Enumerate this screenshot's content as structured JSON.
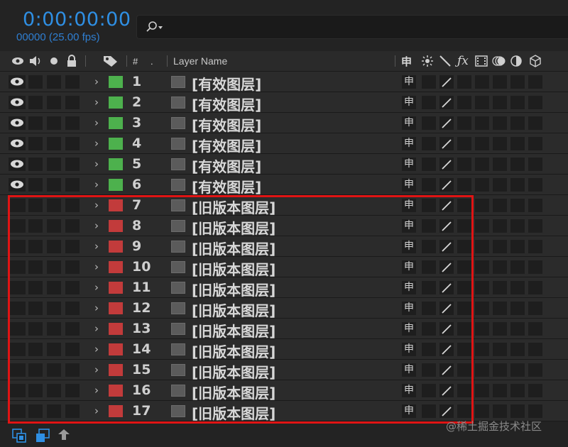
{
  "composition": {
    "timecode": "0:00:00:00",
    "frame_fps": "00000 (25.00 fps)"
  },
  "search": {
    "value": "",
    "icon": "search-icon"
  },
  "header": {
    "number_col": "#",
    "dot_col": ".",
    "layer_name_col": "Layer Name"
  },
  "layers": [
    {
      "num": "1",
      "name": "[有效图层]",
      "visible": true,
      "label_color": "#4db14d"
    },
    {
      "num": "2",
      "name": "[有效图层]",
      "visible": true,
      "label_color": "#4db14d"
    },
    {
      "num": "3",
      "name": "[有效图层]",
      "visible": true,
      "label_color": "#4db14d"
    },
    {
      "num": "4",
      "name": "[有效图层]",
      "visible": true,
      "label_color": "#4db14d"
    },
    {
      "num": "5",
      "name": "[有效图层]",
      "visible": true,
      "label_color": "#4db14d"
    },
    {
      "num": "6",
      "name": "[有效图层]",
      "visible": true,
      "label_color": "#4db14d"
    },
    {
      "num": "7",
      "name": "[旧版本图层]",
      "visible": false,
      "label_color": "#c23b3b"
    },
    {
      "num": "8",
      "name": "[旧版本图层]",
      "visible": false,
      "label_color": "#c23b3b"
    },
    {
      "num": "9",
      "name": "[旧版本图层]",
      "visible": false,
      "label_color": "#c23b3b"
    },
    {
      "num": "10",
      "name": "[旧版本图层]",
      "visible": false,
      "label_color": "#c23b3b"
    },
    {
      "num": "11",
      "name": "[旧版本图层]",
      "visible": false,
      "label_color": "#c23b3b"
    },
    {
      "num": "12",
      "name": "[旧版本图层]",
      "visible": false,
      "label_color": "#c23b3b"
    },
    {
      "num": "13",
      "name": "[旧版本图层]",
      "visible": false,
      "label_color": "#c23b3b"
    },
    {
      "num": "14",
      "name": "[旧版本图层]",
      "visible": false,
      "label_color": "#c23b3b"
    },
    {
      "num": "15",
      "name": "[旧版本图层]",
      "visible": false,
      "label_color": "#c23b3b"
    },
    {
      "num": "16",
      "name": "[旧版本图层]",
      "visible": false,
      "label_color": "#c23b3b"
    },
    {
      "num": "17",
      "name": "[旧版本图层]",
      "visible": false,
      "label_color": "#c23b3b"
    }
  ],
  "switches": {
    "shy_glyph": "申"
  },
  "watermark": "@稀土掘金技术社区",
  "colors": {
    "accent_timecode": "#2f8fe3",
    "highlight_box": "#e01414"
  }
}
